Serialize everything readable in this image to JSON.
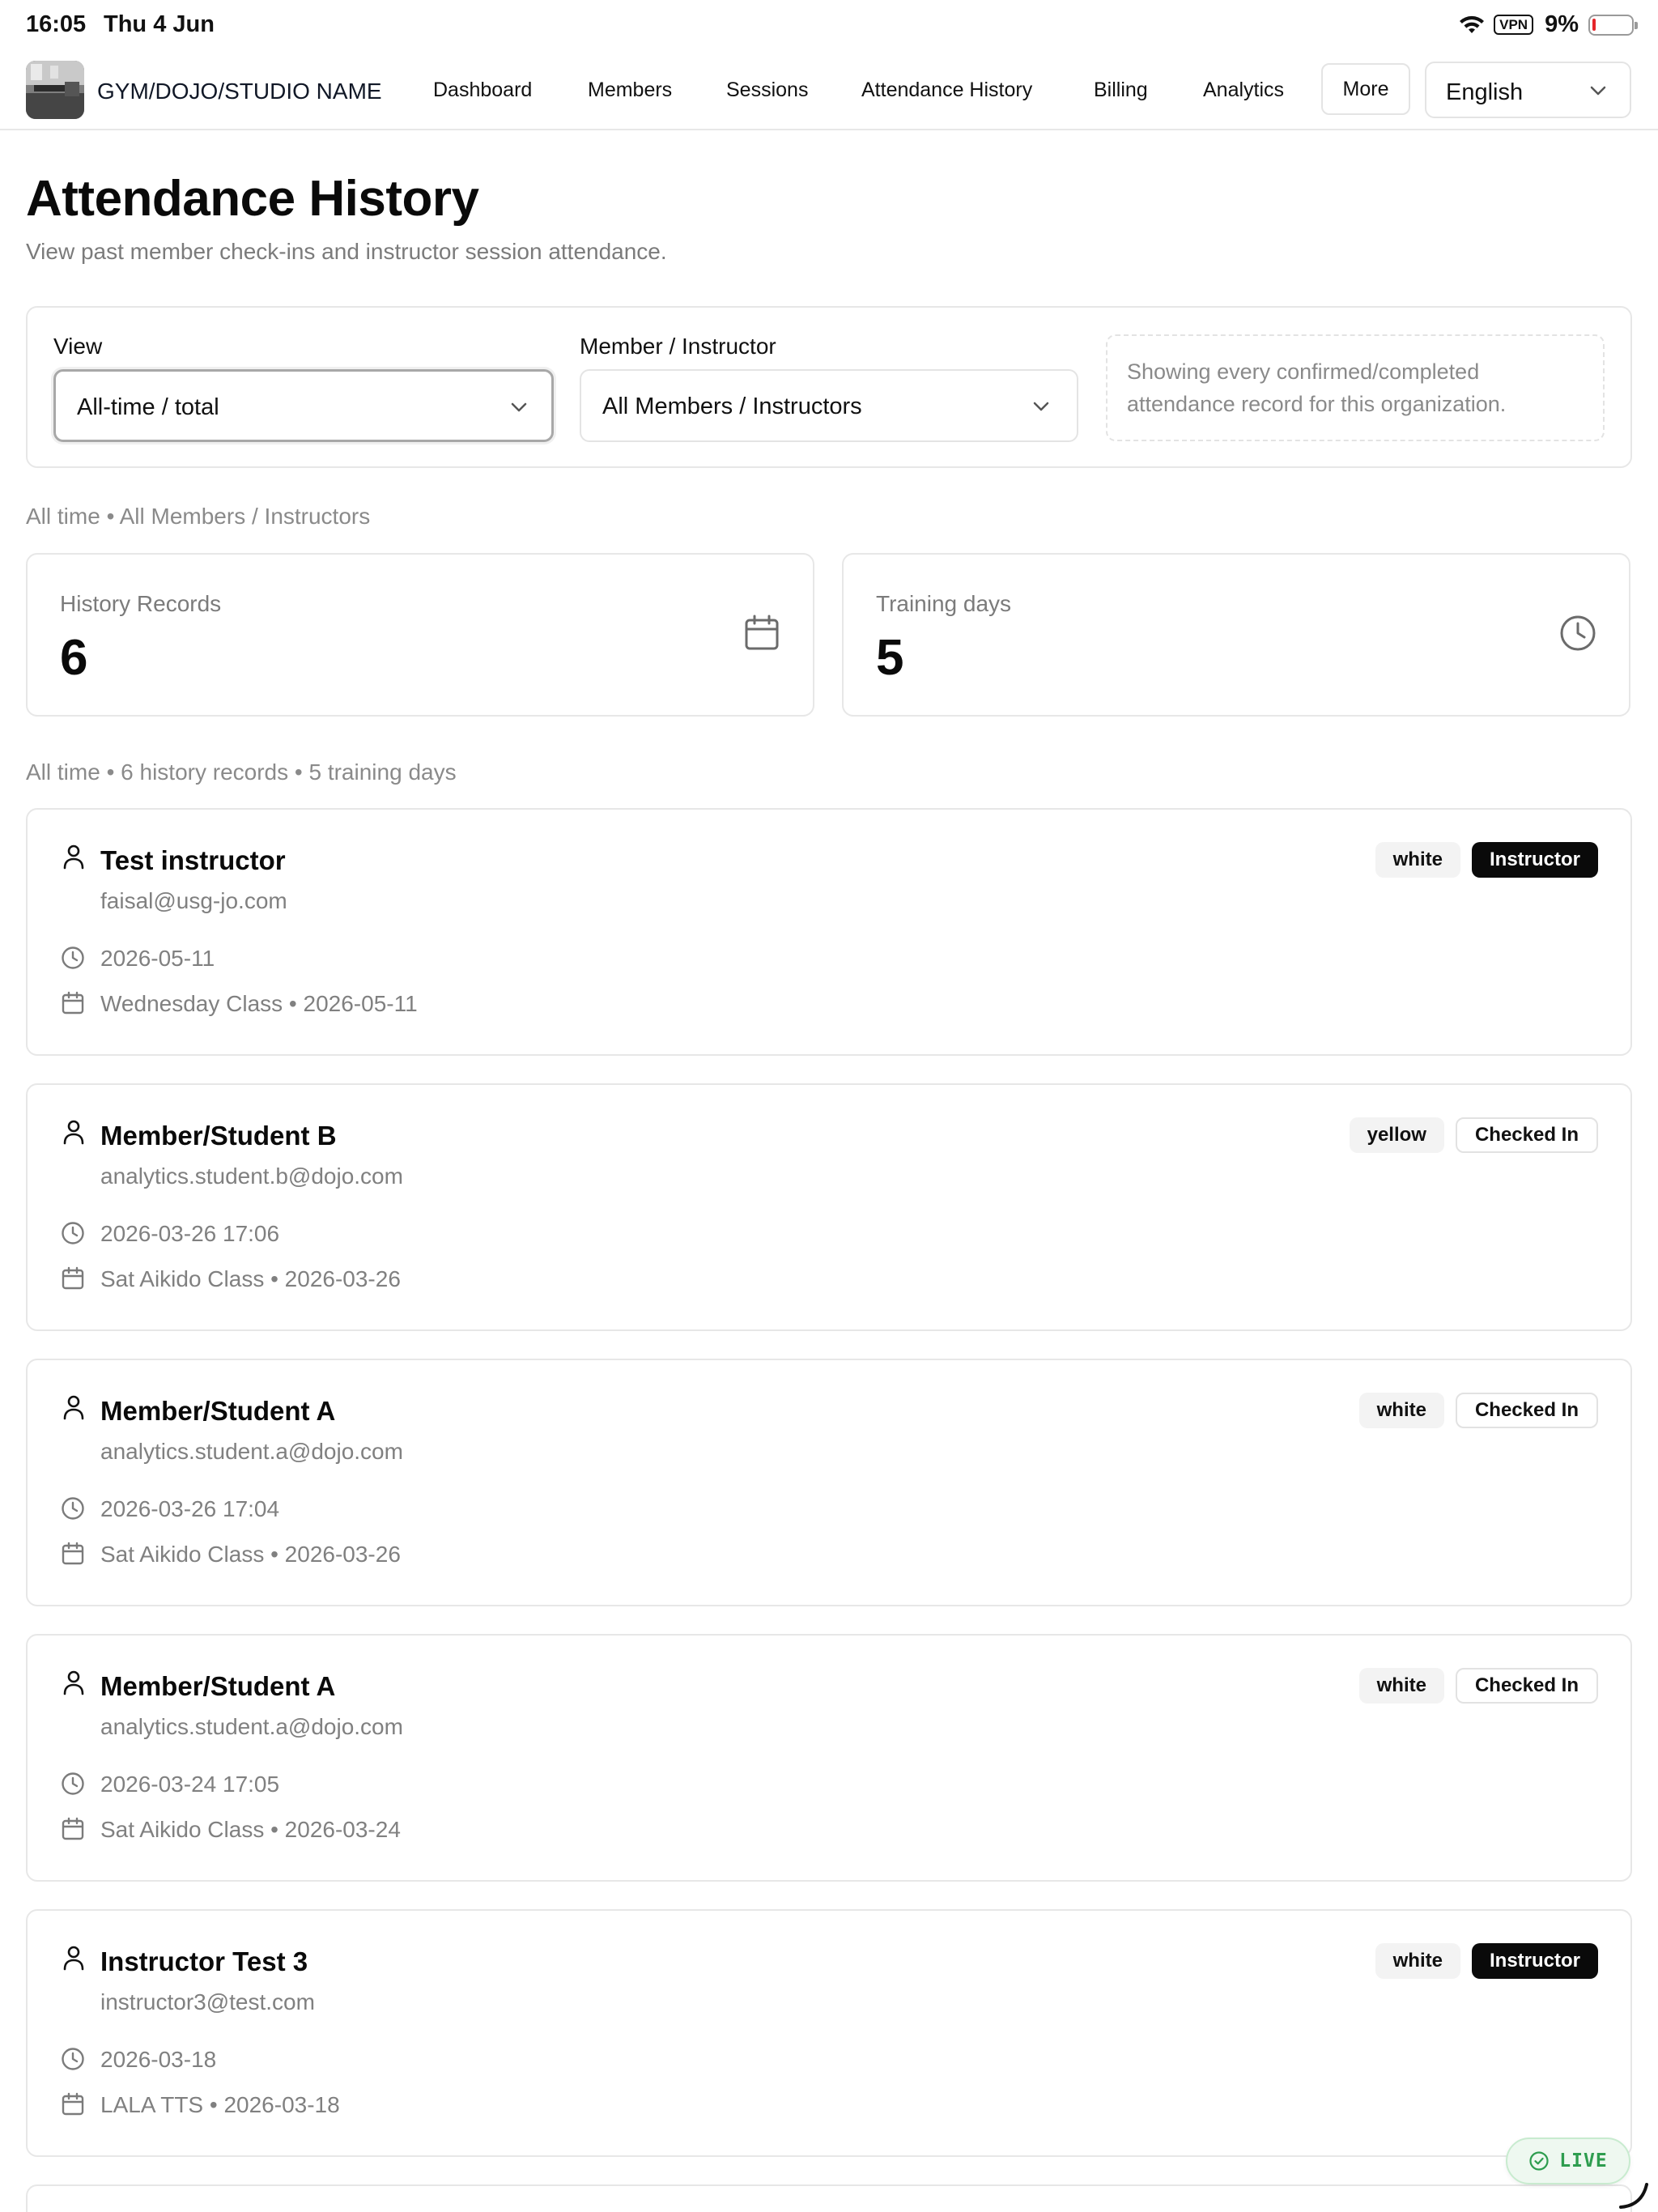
{
  "status_bar": {
    "time": "16:05",
    "date": "Thu 4 Jun",
    "vpn": "VPN",
    "battery": "9%",
    "battery_level": 0.09
  },
  "nav": {
    "org_name": "GYM/DOJO/STUDIO NAME",
    "links": [
      "Dashboard",
      "Members",
      "Sessions",
      "Attendance History",
      "Billing",
      "Analytics"
    ],
    "more": "More",
    "language": "English"
  },
  "header": {
    "title": "Attendance History",
    "subtitle": "View past member check-ins and instructor session attendance."
  },
  "filters": {
    "view_label": "View",
    "view_value": "All-time / total",
    "person_label": "Member / Instructor",
    "person_value": "All Members / Instructors",
    "note": "Showing every confirmed/completed attendance record for this organization."
  },
  "scope_line": "All time • All Members / Instructors",
  "stats": {
    "records_label": "History Records",
    "records_value": "6",
    "days_label": "Training days",
    "days_value": "5"
  },
  "summary_line": "All time • 6 history records • 5 training days",
  "records": [
    {
      "name": "Test instructor",
      "email": "faisal@usg-jo.com",
      "time": "2026-05-11",
      "session": "Wednesday Class • 2026-05-11",
      "belt": "white",
      "role": "Instructor",
      "role_style": "dark"
    },
    {
      "name": "Member/Student B",
      "email": "analytics.student.b@dojo.com",
      "time": "2026-03-26 17:06",
      "session": "Sat Aikido Class • 2026-03-26",
      "belt": "yellow",
      "role": "Checked In",
      "role_style": "light"
    },
    {
      "name": "Member/Student A",
      "email": "analytics.student.a@dojo.com",
      "time": "2026-03-26 17:04",
      "session": "Sat Aikido Class • 2026-03-26",
      "belt": "white",
      "role": "Checked In",
      "role_style": "light"
    },
    {
      "name": "Member/Student A",
      "email": "analytics.student.a@dojo.com",
      "time": "2026-03-24 17:05",
      "session": "Sat Aikido Class • 2026-03-24",
      "belt": "white",
      "role": "Checked In",
      "role_style": "light"
    },
    {
      "name": "Instructor Test 3",
      "email": "instructor3@test.com",
      "time": "2026-03-18",
      "session": "LALA TTS • 2026-03-18",
      "belt": "white",
      "role": "Instructor",
      "role_style": "dark"
    }
  ],
  "live_label": "LIVE",
  "colors": {
    "accent_dark": "#0a0a0a",
    "muted_text": "#808080",
    "border": "#e7e7e7",
    "live_green": "#2e9d4f",
    "battery_red": "#e5252a"
  }
}
